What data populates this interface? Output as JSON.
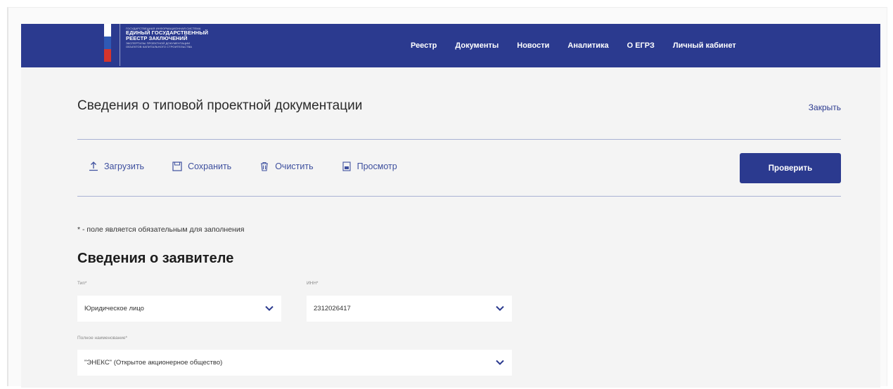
{
  "header": {
    "logo_lines": [
      "Государственная информационная система",
      "Единый государственный",
      "реестр заключений",
      "экспертизы проектной документации",
      "объектов капитального строительства"
    ],
    "nav": [
      "Реестр",
      "Документы",
      "Новости",
      "Аналитика",
      "О ЕГРЗ",
      "Личный кабинет"
    ]
  },
  "page": {
    "title": "Сведения о типовой проектной документации",
    "close_label": "Закрыть"
  },
  "toolbar": {
    "upload": "Загрузить",
    "save": "Сохранить",
    "clear": "Очистить",
    "preview": "Просмотр",
    "check": "Проверить"
  },
  "form": {
    "required_note": "* - поле является обязательным для заполнения",
    "section_title": "Сведения о заявителе",
    "type_label": "Тип*",
    "type_value": "Юридическое лицо",
    "inn_label": "ИНН*",
    "inn_value": "2312026417",
    "fullname_label": "Полное наименование*",
    "fullname_value": "\"ЭНЕКС\" (Открытое акционерное общество)"
  },
  "colors": {
    "brand": "#2b3a8f",
    "page_bg": "#f4f4f4"
  }
}
